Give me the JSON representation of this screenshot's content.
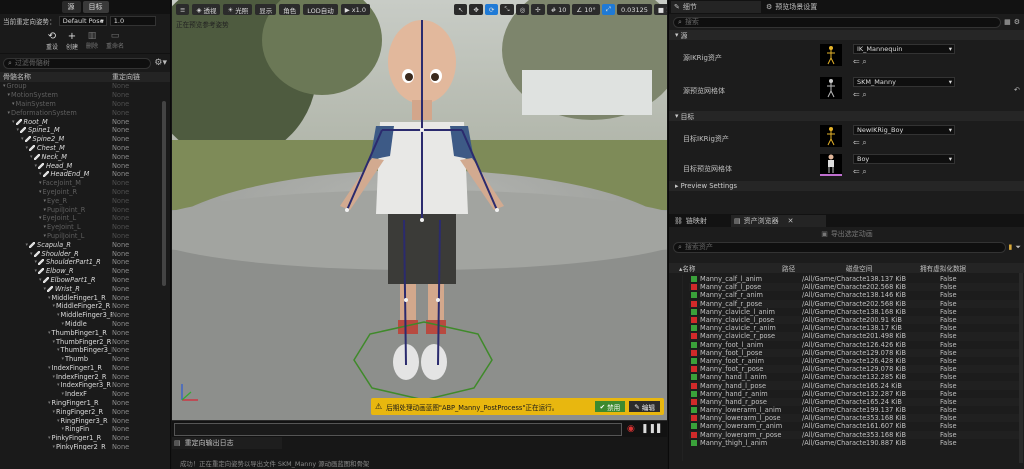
{
  "left": {
    "tabs": [
      "源",
      "目标"
    ],
    "retarget_pose_label": "当前重定向姿势：",
    "retarget_pose_value": "Default Pose",
    "blend_value": "1.0",
    "tools": [
      {
        "icon": "reset-icon",
        "label": "重设"
      },
      {
        "icon": "create-icon",
        "label": "创建"
      },
      {
        "icon": "delete-icon",
        "label": "删除"
      },
      {
        "icon": "rename-icon",
        "label": "重命名"
      }
    ],
    "filter_placeholder": "过滤骨骼树",
    "col_bone": "骨骼名称",
    "col_chain": "重定向链",
    "bones": [
      {
        "n": "Group",
        "c": "None",
        "d": 0,
        "dim": true
      },
      {
        "n": "MotionSystem",
        "c": "None",
        "d": 1,
        "dim": true
      },
      {
        "n": "MainSystem",
        "c": "None",
        "d": 2,
        "dim": true
      },
      {
        "n": "DeformationSystem",
        "c": "None",
        "d": 1,
        "dim": true
      },
      {
        "n": "Root_M",
        "c": "None",
        "d": 2,
        "b": true
      },
      {
        "n": "Spine1_M",
        "c": "None",
        "d": 3,
        "b": true
      },
      {
        "n": "Spine2_M",
        "c": "None",
        "d": 4,
        "b": true
      },
      {
        "n": "Chest_M",
        "c": "None",
        "d": 5,
        "b": true
      },
      {
        "n": "Neck_M",
        "c": "None",
        "d": 6,
        "b": true
      },
      {
        "n": "Head_M",
        "c": "None",
        "d": 7,
        "b": true
      },
      {
        "n": "HeadEnd_M",
        "c": "None",
        "d": 8,
        "b": true
      },
      {
        "n": "FaceJoint_M",
        "c": "None",
        "d": 8,
        "dim": true
      },
      {
        "n": "EyeJoint_R",
        "c": "None",
        "d": 8,
        "dim": true
      },
      {
        "n": "Eye_R",
        "c": "None",
        "d": 9,
        "dim": true
      },
      {
        "n": "PupilJoint_R",
        "c": "None",
        "d": 9,
        "dim": true
      },
      {
        "n": "EyeJoint_L",
        "c": "None",
        "d": 8,
        "dim": true
      },
      {
        "n": "EyeJoint_L",
        "c": "None",
        "d": 9,
        "dim": true
      },
      {
        "n": "PupilJoint_L",
        "c": "None",
        "d": 9,
        "dim": true
      },
      {
        "n": "Scapula_R",
        "c": "None",
        "d": 5,
        "b": true
      },
      {
        "n": "Shoulder_R",
        "c": "None",
        "d": 6,
        "b": true
      },
      {
        "n": "ShoulderPart1_R",
        "c": "None",
        "d": 7,
        "b": true
      },
      {
        "n": "Elbow_R",
        "c": "None",
        "d": 7,
        "b": true
      },
      {
        "n": "ElbowPart1_R",
        "c": "None",
        "d": 8,
        "b": true
      },
      {
        "n": "Wrist_R",
        "c": "None",
        "d": 9,
        "b": true
      },
      {
        "n": "MiddleFinger1_R",
        "c": "None",
        "d": 10
      },
      {
        "n": "MiddleFinger2_R",
        "c": "None",
        "d": 11
      },
      {
        "n": "MiddleFinger3_R",
        "c": "None",
        "d": 12
      },
      {
        "n": "Middle",
        "c": "None",
        "d": 13
      },
      {
        "n": "ThumbFinger1_R",
        "c": "None",
        "d": 10
      },
      {
        "n": "ThumbFinger2_R",
        "c": "None",
        "d": 11
      },
      {
        "n": "ThumbFinger3_R",
        "c": "None",
        "d": 12
      },
      {
        "n": "Thumb",
        "c": "None",
        "d": 13
      },
      {
        "n": "IndexFinger1_R",
        "c": "None",
        "d": 10
      },
      {
        "n": "IndexFinger2_R",
        "c": "None",
        "d": 11
      },
      {
        "n": "IndexFinger3_R",
        "c": "None",
        "d": 12
      },
      {
        "n": "IndexF",
        "c": "None",
        "d": 13
      },
      {
        "n": "RingFinger1_R",
        "c": "None",
        "d": 10
      },
      {
        "n": "RingFinger2_R",
        "c": "None",
        "d": 11
      },
      {
        "n": "RingFinger3_R",
        "c": "None",
        "d": 12
      },
      {
        "n": "RingFin",
        "c": "None",
        "d": 13
      },
      {
        "n": "PinkyFinger1_R",
        "c": "None",
        "d": 10
      },
      {
        "n": "PinkyFinger2_R",
        "c": "None",
        "d": 11
      }
    ]
  },
  "viewport": {
    "buttons": [
      "透视",
      "光照",
      "显示",
      "角色",
      "LOD自动",
      "x1.0"
    ],
    "grid_value": "10",
    "angle_value": "10°",
    "scale_value": "0.03125",
    "cam_value": "1",
    "hint": "正在预览参考姿势",
    "notice": "后期处理动画蓝图\"ABP_Manny_PostProcess\"正在运行。",
    "disable_label": "禁用",
    "edit_label": "编辑",
    "colors": {
      "notice_bg": "#e8b70f",
      "disable_bg": "#3d8a2e"
    }
  },
  "output": {
    "tab": "重定向输出日志",
    "line": "成功！正在重定向姿势以导出文件 SKM_Manny 源动画蓝图和骨架"
  },
  "right": {
    "tabs": [
      "细节",
      "预览场景设置"
    ],
    "search_placeholder": "搜索",
    "sections": {
      "source": "源",
      "target": "目标",
      "preview": "Preview Settings"
    },
    "props": {
      "src_ik": "源IKRig资产",
      "src_ik_val": "IK_Mannequin",
      "src_mesh": "源预览网格体",
      "src_mesh_val": "SKM_Manny",
      "tgt_ik": "目标IKRig资产",
      "tgt_ik_val": "NewIKRig_Boy",
      "tgt_mesh": "目标预览网格体",
      "tgt_mesh_val": "Boy"
    },
    "lower_tabs": [
      "链映射",
      "资产浏览器"
    ],
    "export_label": "导出选定动画",
    "search_assets": "搜索资产",
    "cols": [
      "名称",
      "路径",
      "磁盘空间",
      "拥有虚拟化数据"
    ],
    "assets": [
      {
        "n": "Manny_calf_l_anim",
        "p": "/All/Game/Characte",
        "s": "138.137 KiB",
        "v": "False",
        "t": "anim"
      },
      {
        "n": "Manny_calf_l_pose",
        "p": "/All/Game/Characte",
        "s": "202.568 KiB",
        "v": "False",
        "t": "pose"
      },
      {
        "n": "Manny_calf_r_anim",
        "p": "/All/Game/Characte",
        "s": "138.146 KiB",
        "v": "False",
        "t": "anim"
      },
      {
        "n": "Manny_calf_r_pose",
        "p": "/All/Game/Characte",
        "s": "202.568 KiB",
        "v": "False",
        "t": "pose"
      },
      {
        "n": "Manny_clavicle_l_anim",
        "p": "/All/Game/Characte",
        "s": "138.168 KiB",
        "v": "False",
        "t": "anim"
      },
      {
        "n": "Manny_clavicle_l_pose",
        "p": "/All/Game/Characte",
        "s": "200.91 KiB",
        "v": "False",
        "t": "pose"
      },
      {
        "n": "Manny_clavicle_r_anim",
        "p": "/All/Game/Characte",
        "s": "138.17 KiB",
        "v": "False",
        "t": "anim"
      },
      {
        "n": "Manny_clavicle_r_pose",
        "p": "/All/Game/Characte",
        "s": "201.498 KiB",
        "v": "False",
        "t": "pose"
      },
      {
        "n": "Manny_foot_l_anim",
        "p": "/All/Game/Characte",
        "s": "126.426 KiB",
        "v": "False",
        "t": "anim"
      },
      {
        "n": "Manny_foot_l_pose",
        "p": "/All/Game/Characte",
        "s": "129.078 KiB",
        "v": "False",
        "t": "pose"
      },
      {
        "n": "Manny_foot_r_anim",
        "p": "/All/Game/Characte",
        "s": "126.428 KiB",
        "v": "False",
        "t": "anim"
      },
      {
        "n": "Manny_foot_r_pose",
        "p": "/All/Game/Characte",
        "s": "129.078 KiB",
        "v": "False",
        "t": "pose"
      },
      {
        "n": "Manny_hand_l_anim",
        "p": "/All/Game/Characte",
        "s": "132.285 KiB",
        "v": "False",
        "t": "anim"
      },
      {
        "n": "Manny_hand_l_pose",
        "p": "/All/Game/Characte",
        "s": "165.24 KiB",
        "v": "False",
        "t": "pose"
      },
      {
        "n": "Manny_hand_r_anim",
        "p": "/All/Game/Characte",
        "s": "132.287 KiB",
        "v": "False",
        "t": "anim"
      },
      {
        "n": "Manny_hand_r_pose",
        "p": "/All/Game/Characte",
        "s": "165.24 KiB",
        "v": "False",
        "t": "pose"
      },
      {
        "n": "Manny_lowerarm_l_anim",
        "p": "/All/Game/Characte",
        "s": "199.137 KiB",
        "v": "False",
        "t": "anim"
      },
      {
        "n": "Manny_lowerarm_l_pose",
        "p": "/All/Game/Characte",
        "s": "353.168 KiB",
        "v": "False",
        "t": "pose"
      },
      {
        "n": "Manny_lowerarm_r_anim",
        "p": "/All/Game/Characte",
        "s": "161.607 KiB",
        "v": "False",
        "t": "anim"
      },
      {
        "n": "Manny_lowerarm_r_pose",
        "p": "/All/Game/Characte",
        "s": "353.168 KiB",
        "v": "False",
        "t": "pose"
      },
      {
        "n": "Manny_thigh_l_anim",
        "p": "/All/Game/Characte",
        "s": "190.887 KiB",
        "v": "False",
        "t": "anim"
      }
    ],
    "colors": {
      "anim": "#3aa13a",
      "pose": "#d12a2a",
      "accent": "#1f7ad6"
    }
  }
}
